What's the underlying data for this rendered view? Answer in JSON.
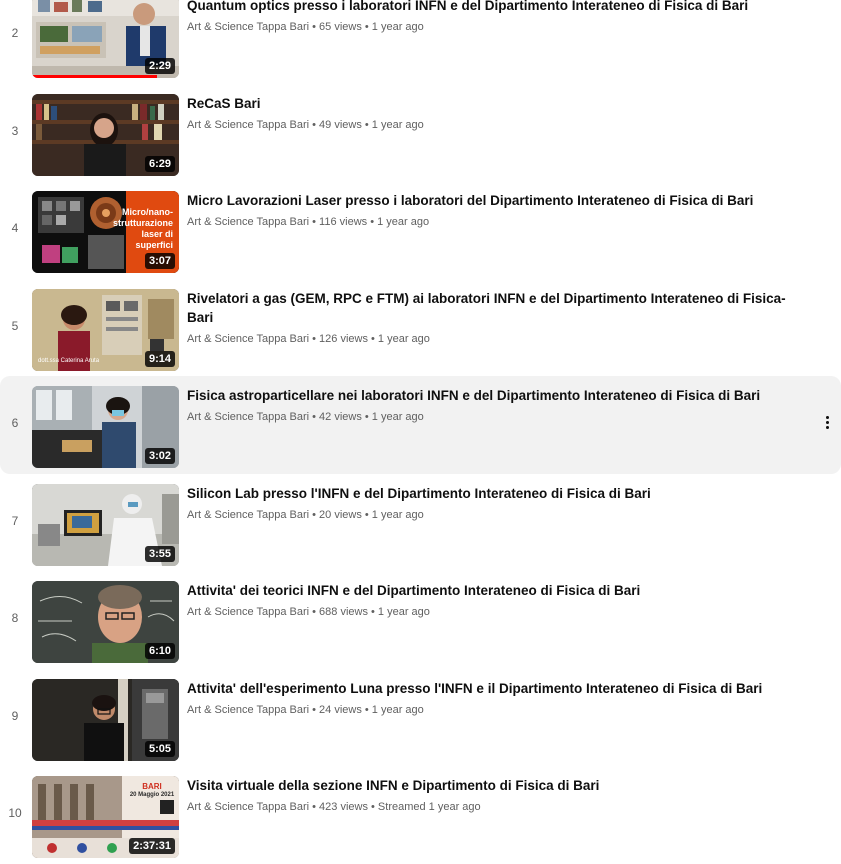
{
  "channel": "Art & Science Tappa Bari",
  "videos": [
    {
      "index": "2",
      "title": "Quantum optics presso i laboratori INFN e del Dipartimento Interateneo di Fisica di Bari",
      "meta": "Art & Science Tappa Bari • 65 views • 1 year ago",
      "duration": "2:29",
      "watched": 0.85
    },
    {
      "index": "3",
      "title": "ReCaS Bari",
      "meta": "Art & Science Tappa Bari • 49 views • 1 year ago",
      "duration": "6:29"
    },
    {
      "index": "4",
      "title": "Micro Lavorazioni Laser presso i laboratori del Dipartimento Interateneo di Fisica di Bari",
      "meta": "Art & Science Tappa Bari • 116 views • 1 year ago",
      "duration": "3:07",
      "overlay": [
        "Micro/nano-",
        "strutturazione",
        "laser di",
        "superfici"
      ]
    },
    {
      "index": "5",
      "title_line1": "Rivelatori a gas (GEM, RPC e FTM) ai laboratori INFN e del Dipartimento Interateneo di Fisica-",
      "title_line2": "Bari",
      "meta": "Art & Science Tappa Bari • 126 views • 1 year ago",
      "duration": "9:14",
      "caption": "dott.ssa Caterina Aruta"
    },
    {
      "index": "6",
      "title": "Fisica astroparticellare nei laboratori INFN e del Dipartimento Interateneo di Fisica di Bari",
      "meta": "Art & Science Tappa Bari • 42 views • 1 year ago",
      "duration": "3:02",
      "hovered": true
    },
    {
      "index": "7",
      "title": "Silicon Lab presso l'INFN e del Dipartimento Interateneo di Fisica di Bari",
      "meta": "Art & Science Tappa Bari • 20 views • 1 year ago",
      "duration": "3:55"
    },
    {
      "index": "8",
      "title": "Attivita' dei teorici INFN e del Dipartimento Interateneo di Fisica di Bari",
      "meta": "Art & Science Tappa Bari • 688 views • 1 year ago",
      "duration": "6:10"
    },
    {
      "index": "9",
      "title": "Attivita' dell'esperimento Luna presso l'INFN e il Dipartimento Interateneo di Fisica di Bari",
      "meta": "Art & Science Tappa Bari • 24 views • 1 year ago",
      "duration": "5:05"
    },
    {
      "index": "10",
      "title": "Visita virtuale della sezione INFN e Dipartimento di Fisica di Bari",
      "meta": "Art & Science Tappa Bari • 423 views • Streamed 1 year ago",
      "duration": "2:37:31",
      "poster": [
        "BARI",
        "20 Maggio 2021"
      ]
    }
  ],
  "colors": {
    "hover_bg": "#f2f2f2",
    "text_primary": "#0f0f0f",
    "text_secondary": "#606060",
    "progress": "#ff0000"
  },
  "icons": {
    "row_menu": "more-vertical-icon"
  }
}
